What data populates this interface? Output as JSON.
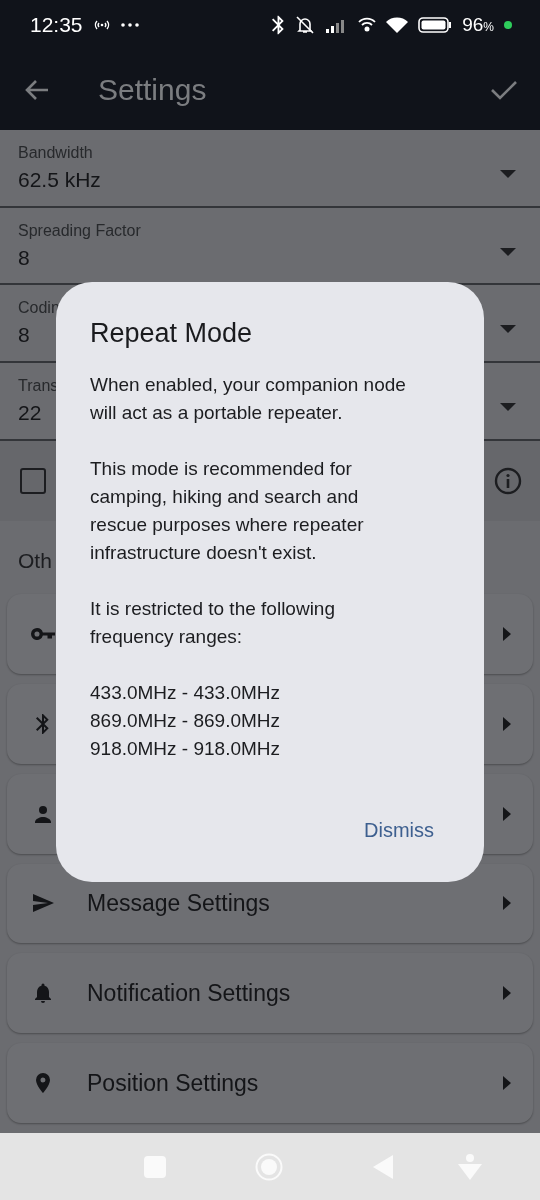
{
  "status_bar": {
    "time": "12:35",
    "battery": "96",
    "battery_unit": "%"
  },
  "app_bar": {
    "title": "Settings"
  },
  "fields": [
    {
      "label": "Bandwidth",
      "value": "62.5 kHz"
    },
    {
      "label": "Spreading Factor",
      "value": "8"
    },
    {
      "label": "Codin",
      "value": "8"
    },
    {
      "label": "Trans",
      "value": "22"
    }
  ],
  "checkbox_row": {
    "checked": false
  },
  "section_title": "Oth",
  "menu_items": [
    {
      "kind": "key"
    },
    {
      "kind": "bluetooth"
    },
    {
      "kind": "person"
    },
    {
      "kind": "send",
      "label": "Message Settings"
    },
    {
      "kind": "bell",
      "label": "Notification Settings"
    },
    {
      "kind": "pin",
      "label": "Position Settings"
    }
  ],
  "dialog": {
    "title": "Repeat Mode",
    "paragraphs": [
      [
        "When enabled, your companion node",
        "will act as a portable repeater."
      ],
      [
        "This mode is recommended for",
        "camping, hiking and search and",
        "rescue purposes where repeater",
        "infrastructure doesn't exist."
      ],
      [
        "It is restricted to the following",
        "frequency ranges:"
      ],
      [
        "433.0MHz - 433.0MHz",
        "869.0MHz - 869.0MHz",
        "918.0MHz - 918.0MHz"
      ]
    ],
    "button": "Dismiss"
  }
}
